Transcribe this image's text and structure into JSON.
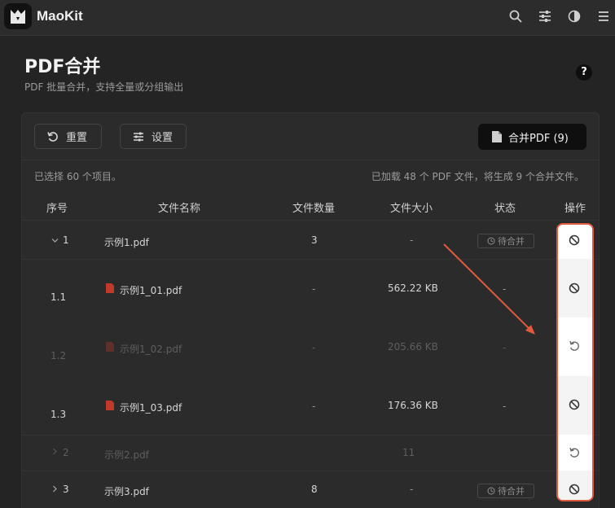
{
  "app": {
    "name": "MaoKit"
  },
  "page": {
    "title": "PDF合并",
    "subtitle": "PDF 批量合并，支持全量或分组输出",
    "help": "?"
  },
  "toolbar": {
    "reset_label": "重置",
    "settings_label": "设置",
    "merge_label": "合并PDF (9)"
  },
  "info": {
    "selected": "已选择 60 个项目。",
    "summary": "已加载 48 个 PDF 文件，将生成 9 个合并文件。"
  },
  "table": {
    "headers": {
      "index": "序号",
      "name": "文件名称",
      "count": "文件数量",
      "size": "文件大小",
      "status": "状态",
      "ops": "操作"
    },
    "rows": [
      {
        "index": "1",
        "name": "示例1.pdf",
        "count": "3",
        "size": "-",
        "status": "待合并"
      },
      {
        "index": "1.1",
        "name": "示例1_01.pdf",
        "count": "-",
        "size": "562.22 KB",
        "status": "-"
      },
      {
        "index": "1.2",
        "name": "示例1_02.pdf",
        "count": "-",
        "size": "205.66 KB",
        "status": "-"
      },
      {
        "index": "1.3",
        "name": "示例1_03.pdf",
        "count": "-",
        "size": "176.36 KB",
        "status": "-"
      },
      {
        "index": "2",
        "name": "示例2.pdf",
        "count": "",
        "size": "11",
        "status": ""
      },
      {
        "index": "3",
        "name": "示例3.pdf",
        "count": "8",
        "size": "-",
        "status": "待合并"
      }
    ]
  },
  "colors": {
    "accent": "#e05a3d",
    "background": "#242424",
    "card": "#2b2b2b"
  },
  "icons": [
    "search-icon",
    "sliders-icon",
    "contrast-icon",
    "menu-icon",
    "undo-icon",
    "settings-icon",
    "pdf-file-icon",
    "clock-icon",
    "ban-icon",
    "restore-icon",
    "chevron-down-icon",
    "chevron-right-icon"
  ]
}
